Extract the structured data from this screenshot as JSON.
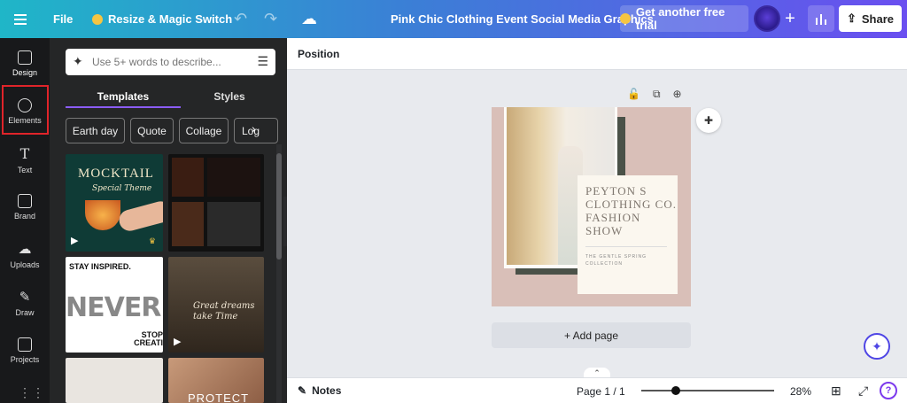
{
  "topbar": {
    "file_label": "File",
    "resize_label": "Resize & Magic Switch",
    "doc_title": "Pink Chic Clothing Event Social Media Graphics",
    "trial_label": "Get another free trial",
    "share_label": "Share"
  },
  "rail": {
    "items": [
      {
        "label": "Design"
      },
      {
        "label": "Elements"
      },
      {
        "label": "Text"
      },
      {
        "label": "Brand"
      },
      {
        "label": "Uploads"
      },
      {
        "label": "Draw"
      },
      {
        "label": "Projects"
      }
    ]
  },
  "panel": {
    "search_placeholder": "Use 5+ words to describe...",
    "tabs": [
      {
        "label": "Templates"
      },
      {
        "label": "Styles"
      }
    ],
    "chips": [
      {
        "label": "Earth day"
      },
      {
        "label": "Quote"
      },
      {
        "label": "Collage"
      },
      {
        "label": "Log"
      }
    ],
    "thumbs": {
      "mocktail_title": "MOCKTAIL",
      "mocktail_sub": "Special Theme",
      "never_top": "STAY INSPIRED.",
      "never_word": "NEVER",
      "never_bottom": "STOP CREATI",
      "hall_text": "Great dreams take Time",
      "protect": "PROTECT"
    }
  },
  "workspace": {
    "position_label": "Position",
    "canvas_title": "PEYTON S CLOTHING CO. FASHION SHOW",
    "canvas_sub": "THE GENTLE SPRING COLLECTION",
    "add_page": "+ Add page",
    "notes_label": "Notes",
    "page_indicator": "Page 1 / 1",
    "zoom": "28%",
    "zoom_fraction": 0.28
  }
}
